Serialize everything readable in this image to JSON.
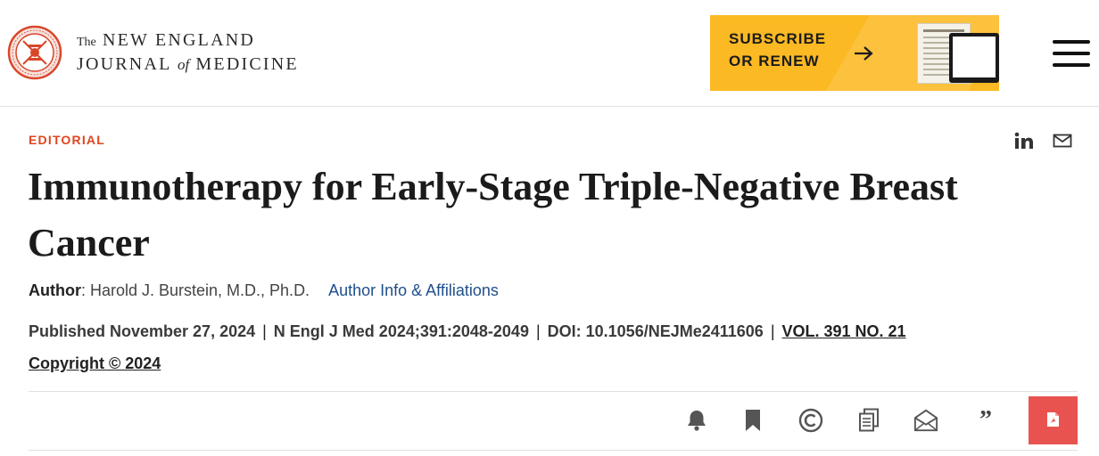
{
  "header": {
    "seal_icon": "nejm-seal-logo",
    "masthead": {
      "the": "The",
      "new_england": "NEW ENGLAND",
      "journal": "JOURNAL",
      "of": "of",
      "medicine": "MEDICINE"
    },
    "subscribe": {
      "line1": "SUBSCRIBE",
      "line2": "OR RENEW",
      "arrow_icon": "arrow-right-icon"
    },
    "menu_icon": "hamburger-menu-icon"
  },
  "article": {
    "category": "EDITORIAL",
    "title": "Immunotherapy for Early-Stage Triple-Negative Breast Cancer",
    "author_label": "Author",
    "author_name": ": Harold J. Burstein, M.D., Ph.D.",
    "affiliations_link": "Author Info & Affiliations",
    "published": "Published November 27, 2024",
    "citation": "N Engl J Med 2024;391:2048-2049",
    "doi": "DOI: 10.1056/NEJMe2411606",
    "volume": "VOL. 391 NO. 21",
    "copyright": "Copyright © 2024",
    "separator": "|"
  },
  "share": {
    "linkedin_icon": "linkedin-icon",
    "email_icon": "email-icon"
  },
  "toolbar": {
    "icons": [
      "bell-icon",
      "bookmark-icon",
      "copyright-icon",
      "copy-icon",
      "envelope-open-icon",
      "quote-icon",
      "pdf-icon"
    ],
    "quote_glyph": "”"
  },
  "colors": {
    "accent": "#e0451f",
    "subscribe_bg": "#fbb923",
    "link": "#1f4f8b",
    "pdf_bg": "#e8534f"
  }
}
